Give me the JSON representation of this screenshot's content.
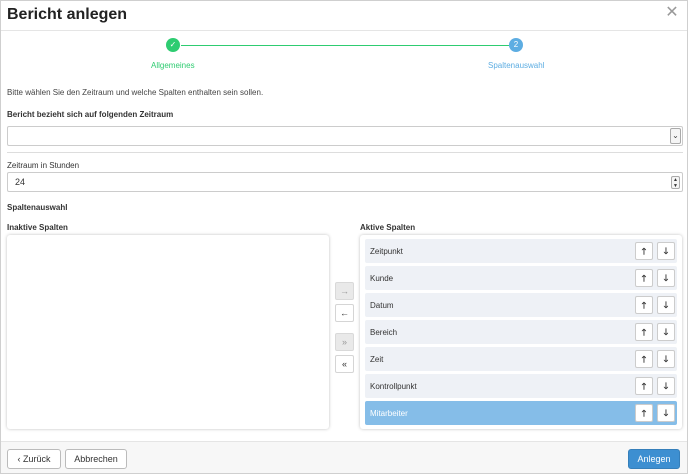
{
  "dialog": {
    "title": "Bericht anlegen",
    "close_icon": "close-icon"
  },
  "stepper": {
    "steps": [
      {
        "label": "Allgemeines",
        "marker": "✓",
        "state": "done",
        "color": "#2ecc71"
      },
      {
        "label": "Spaltenauswahl",
        "marker": "2",
        "state": "current",
        "color": "#5dade2"
      }
    ]
  },
  "intro": "Bitte wählen Sie den Zeitraum und welche Spalten enthalten sein sollen.",
  "period": {
    "label": "Bericht bezieht sich auf folgenden Zeitraum",
    "value": ""
  },
  "hours": {
    "label": "Zeitraum in Stunden",
    "value": "24"
  },
  "columns": {
    "section_title": "Spaltenauswahl",
    "inactive_label": "Inaktive Spalten",
    "active_label": "Aktive Spalten",
    "inactive_items": [],
    "active_items": [
      {
        "label": "Zeitpunkt",
        "selected": false
      },
      {
        "label": "Kunde",
        "selected": false
      },
      {
        "label": "Datum",
        "selected": false
      },
      {
        "label": "Bereich",
        "selected": false
      },
      {
        "label": "Zeit",
        "selected": false
      },
      {
        "label": "Kontrollpunkt",
        "selected": false
      },
      {
        "label": "Mitarbeiter",
        "selected": true
      }
    ],
    "transfer_buttons": [
      {
        "glyph": "→",
        "icon": "arrow-right-icon",
        "disabled": true
      },
      {
        "glyph": "←",
        "icon": "arrow-left-icon",
        "disabled": false
      },
      {
        "glyph": "»",
        "icon": "double-chevron-right-icon",
        "disabled": true
      },
      {
        "glyph": "«",
        "icon": "double-chevron-left-icon",
        "disabled": false
      }
    ],
    "up_glyph": "🡑",
    "down_glyph": "🡓"
  },
  "footer": {
    "back_label": "‹ Zurück",
    "cancel_label": "Abbrechen",
    "create_label": "Anlegen"
  },
  "colors": {
    "accent": "#3d8fd1",
    "success": "#2ecc71",
    "selected_item": "#85bde8"
  }
}
